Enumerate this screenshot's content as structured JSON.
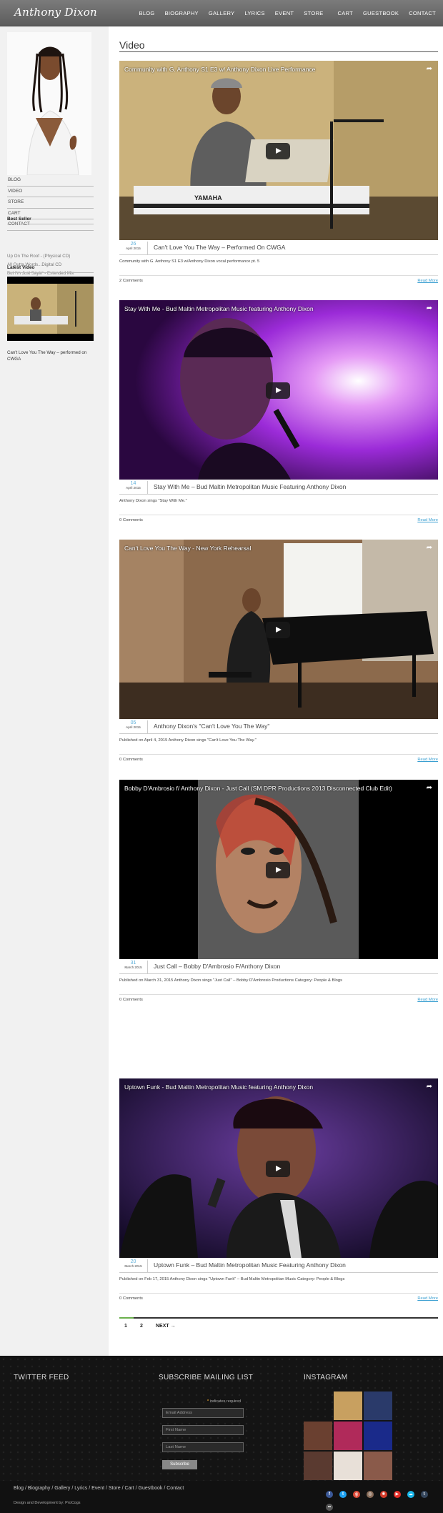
{
  "site": {
    "logo": "Anthony Dixon"
  },
  "nav": [
    "BLOG",
    "BIOGRAPHY",
    "GALLERY",
    "LYRICS",
    "EVENT",
    "STORE",
    "CART",
    "GUESTBOOK",
    "CONTACT"
  ],
  "sidebar": {
    "menu": [
      "BLOG",
      "VIDEO",
      "STORE",
      "CART",
      "CONTACT"
    ],
    "best_seller_heading": "Best Seller",
    "best_sellers": [
      "Up On The Roof - (Physical CD)",
      "All Outta Words...Digital CD",
      "But I'm Just Sayin' - Extended Mix"
    ],
    "latest_video_heading": "Latest Video",
    "latest_video_caption": "Can't Love You The Way – performed on CWGA"
  },
  "page": {
    "title": "Video"
  },
  "posts": [
    {
      "video_title": "Community with G. Anthony S1 E3 w/ Anthony Dixon Live Performance",
      "day": "26",
      "month": "April 2015",
      "title": "Can't Love You The Way – Performed On CWGA",
      "excerpt": "Community with G. Anthony S1 E3 w/Anthony Dixon vocal performance pt. 5",
      "comments": "2 Comments",
      "read_more": "Read More"
    },
    {
      "video_title": "Stay With Me - Bud Maltin Metropolitan Music featuring Anthony Dixon",
      "day": "14",
      "month": "April 2015",
      "title": "Stay With Me – Bud Maltin Metropolitan Music Featuring Anthony Dixon",
      "excerpt": "Anthony Dixon sings \"Stay With Me.\"",
      "comments": "0 Comments",
      "read_more": "Read More"
    },
    {
      "video_title": "Can't Love You The Way - New York Rehearsal",
      "day": "05",
      "month": "April 2015",
      "title": "Anthony Dixon's \"Can't Love You The Way\"",
      "excerpt": "Published on April 4, 2015 Anthony Dixon sings \"Can't Love You The Way.\"",
      "comments": "0 Comments",
      "read_more": "Read More"
    },
    {
      "video_title": "Bobby D'Ambrosio f/ Anthony Dixon - Just Call (SM DPR Productions 2013 Disconnected Club Edit)",
      "day": "31",
      "month": "March 2015",
      "title": "Just Call – Bobby D'Ambrosio F/Anthony Dixon",
      "excerpt": "Published on March 31, 2015 Anthony Dixon sings \"Just Call\" – Bobby D'Ambrosio Productions Category: People & Blogs",
      "comments": "0 Comments",
      "read_more": "Read More"
    },
    {
      "video_title": "Uptown Funk - Bud Maltin Metropolitan Music featuring Anthony Dixon",
      "day": "20",
      "month": "March 2015",
      "title": "Uptown Funk – Bud Maltin Metropolitan Music Featuring Anthony Dixon",
      "excerpt": "Published on Feb 17, 2015 Anthony Dixon sings \"Uptown Funk\" – Bud Maltin Metropolitan Music Category: People & Blogs",
      "comments": "0 Comments",
      "read_more": "Read More"
    }
  ],
  "pagination": {
    "page1": "1",
    "page2": "2",
    "next": "NEXT →"
  },
  "footer": {
    "twitter_heading": "TWITTER FEED",
    "subscribe_heading": "SUBSCRIBE MAILING LIST",
    "instagram_heading": "INSTAGRAM",
    "required_note": "indicates required",
    "email_placeholder": "Email Address",
    "first_name_placeholder": "First Name",
    "last_name_placeholder": "Last Name",
    "subscribe_button": "Subscribe",
    "links": [
      "Blog",
      "Biography",
      "Gallery",
      "Lyrics",
      "Event",
      "Store",
      "Cart",
      "Guestbook",
      "Contact"
    ],
    "credit": "Design and Development by: ProCogs"
  },
  "colors": {
    "accent": "#5aaed9",
    "link": "#3a9fd1",
    "pager_active": "#6ab04c"
  },
  "social_icons": [
    "facebook-icon",
    "twitter-icon",
    "google-plus-icon",
    "instagram-icon",
    "reverbnation-icon",
    "youtube-icon",
    "soundcloud-icon",
    "tumblr-icon",
    "flickr-icon"
  ]
}
